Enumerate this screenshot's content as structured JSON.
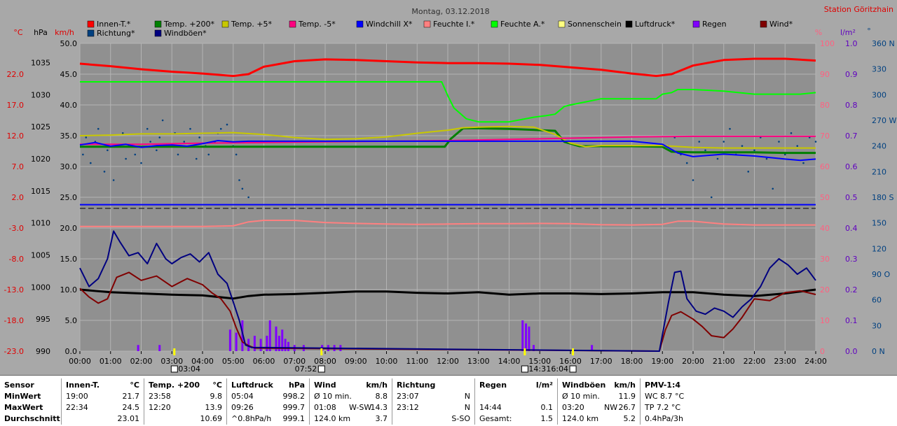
{
  "chart_data": {
    "type": "line",
    "title": "Montag, 03.12.2018",
    "station": "Station Göritzhain",
    "axis_units": {
      "temp": "°C",
      "pressure": "hPa",
      "wind": "km/h",
      "humidity": "%",
      "rain": "l/m²",
      "direction": "°"
    },
    "yaxes": {
      "temp": {
        "range": [
          -23.0,
          27.0
        ],
        "ticks": [
          "22.0",
          "17.0",
          "12.0",
          "7.0",
          "2.0",
          "-3.0",
          "-8.0",
          "-13.0",
          "-18.0",
          "-23.0"
        ]
      },
      "pressure": {
        "range": [
          990,
          1038
        ],
        "ticks": [
          "1035",
          "1030",
          "1025",
          "1020",
          "1015",
          "1010",
          "1005",
          "1000",
          "995",
          "990"
        ]
      },
      "wind": {
        "range": [
          0.0,
          50.0
        ],
        "ticks": [
          "50.0",
          "45.0",
          "40.0",
          "35.0",
          "30.0",
          "25.0",
          "20.0",
          "15.0",
          "10.0",
          "5.0",
          "0.0"
        ]
      },
      "humidity": {
        "range": [
          0,
          100
        ],
        "ticks": [
          "100",
          "90",
          "80",
          "70",
          "60",
          "50",
          "40",
          "30",
          "20",
          "10",
          "0"
        ]
      },
      "rain": {
        "range": [
          0.0,
          1.0
        ],
        "ticks": [
          "1.0",
          "0.9",
          "0.8",
          "0.7",
          "0.6",
          "0.5",
          "0.4",
          "0.3",
          "0.2",
          "0.1",
          "0.0"
        ]
      },
      "direction": {
        "range": [
          0,
          360
        ],
        "ticks": [
          "360 N",
          "330",
          "300",
          "270 W",
          "240",
          "210",
          "180 S",
          "150",
          "120",
          "90 O",
          "60",
          "30",
          "0 N"
        ]
      }
    },
    "x_ticks": [
      "00:00",
      "01:00",
      "02:00",
      "03:00",
      "04:00",
      "05:00",
      "06:00",
      "07:00",
      "08:00",
      "09:00",
      "10:00",
      "11:00",
      "12:00",
      "13:00",
      "14:00",
      "15:00",
      "16:00",
      "17:00",
      "18:00",
      "19:00",
      "20:00",
      "21:00",
      "22:00",
      "23:00",
      "24:00"
    ],
    "x_range": [
      0,
      24
    ],
    "sun_markers": [
      {
        "label": "03:04",
        "x": 3.07
      },
      {
        "label": "07:52",
        "x": 7.87
      },
      {
        "label": "14:3",
        "x": 14.5
      },
      {
        "label": "16:04",
        "x": 16.07
      }
    ],
    "legend": [
      {
        "name": "Innen-T.*",
        "color": "#ff0000"
      },
      {
        "name": "Temp. +200*",
        "color": "#008000"
      },
      {
        "name": "Temp. +5*",
        "color": "#c8c800"
      },
      {
        "name": "Temp. -5*",
        "color": "#ff0080"
      },
      {
        "name": "Windchill X*",
        "color": "#0000ff"
      },
      {
        "name": "Feuchte I.*",
        "color": "#ff8080"
      },
      {
        "name": "Feuchte A.*",
        "color": "#00ff00"
      },
      {
        "name": "Sonnenschein",
        "color": "#ffff80"
      },
      {
        "name": "Luftdruck*",
        "color": "#000000"
      },
      {
        "name": "Regen",
        "color": "#8000ff"
      },
      {
        "name": "Wind*",
        "color": "#800000"
      },
      {
        "name": "Richtung*",
        "color": "#004080"
      },
      {
        "name": "Windböen*",
        "color": "#000080"
      }
    ],
    "series": [
      {
        "name": "Innen-T.*",
        "axis": "temp",
        "color": "#ff0000",
        "width": 3,
        "x": [
          0,
          1,
          2,
          3,
          4,
          5,
          5.5,
          6,
          7,
          8,
          9,
          10,
          11,
          12,
          13,
          14,
          15,
          16,
          17,
          18,
          18.8,
          19.3,
          20,
          21,
          22,
          23,
          24
        ],
        "y": [
          23.7,
          23.3,
          22.8,
          22.4,
          22.1,
          21.7,
          22.0,
          23.2,
          24.1,
          24.4,
          24.3,
          24.1,
          23.9,
          23.8,
          23.8,
          23.7,
          23.5,
          23.1,
          22.7,
          22.1,
          21.7,
          22.0,
          23.4,
          24.3,
          24.5,
          24.5,
          24.2
        ]
      },
      {
        "name": "Temp. +200*",
        "axis": "temp",
        "color": "#008000",
        "width": 3,
        "x": [
          0,
          2,
          4,
          6,
          8,
          10,
          11.9,
          12.1,
          12.5,
          13,
          14,
          15.5,
          15.8,
          16.3,
          17,
          18,
          19,
          19.3,
          20,
          21,
          22,
          23,
          24
        ],
        "y": [
          10.2,
          10.2,
          10.2,
          10.2,
          10.2,
          10.2,
          10.2,
          11.5,
          13.2,
          13.2,
          13.1,
          12.8,
          11.0,
          10.3,
          10.3,
          10.3,
          10.2,
          9.4,
          9.3,
          9.3,
          9.3,
          9.2,
          9.2
        ]
      },
      {
        "name": "Temp. +5*",
        "axis": "temp",
        "color": "#c8c800",
        "width": 2,
        "x": [
          0,
          1,
          2,
          3,
          4,
          5,
          6,
          7,
          8,
          9,
          10,
          11,
          12,
          12.5,
          13,
          14,
          14.8,
          15.5,
          16,
          16.5,
          17,
          18,
          19,
          20,
          21,
          22,
          23,
          24
        ],
        "y": [
          12.0,
          12.1,
          12.3,
          12.3,
          12.4,
          12.5,
          12.2,
          11.7,
          11.4,
          11.5,
          11.8,
          12.4,
          12.9,
          13.3,
          13.4,
          13.5,
          13.4,
          12.2,
          10.8,
          10.2,
          10.4,
          10.4,
          10.4,
          10.1,
          10.0,
          10.0,
          10.0,
          10.0
        ]
      },
      {
        "name": "Temp. -5*",
        "axis": "temp",
        "color": "#ff0080",
        "width": 2,
        "x": [
          0,
          2,
          4,
          6,
          8,
          10,
          12,
          14,
          16,
          18,
          20,
          22,
          24
        ],
        "y": [
          10.6,
          10.6,
          10.8,
          10.9,
          11.0,
          11.1,
          11.2,
          11.4,
          11.6,
          11.8,
          11.9,
          11.9,
          11.9
        ]
      },
      {
        "name": "Windchill X*",
        "axis": "temp",
        "color": "#0000ff",
        "width": 2,
        "x": [
          0,
          0.5,
          1,
          1.5,
          2,
          2.5,
          3,
          3.5,
          4,
          4.5,
          5,
          5.5,
          6,
          7,
          8,
          10,
          12,
          14,
          16,
          18,
          19,
          19.5,
          20,
          21,
          22,
          23,
          23.5,
          24
        ],
        "y": [
          10.5,
          10.9,
          10.3,
          10.6,
          10.1,
          10.4,
          10.5,
          10.3,
          10.7,
          11.2,
          11.0,
          11.1,
          11.1,
          11.1,
          11.1,
          11.1,
          11.1,
          11.1,
          11.1,
          11.1,
          10.6,
          9.2,
          8.6,
          9.0,
          8.7,
          8.2,
          8.0,
          8.2
        ]
      },
      {
        "name": "Windchill X* base",
        "axis": "temp",
        "color": "#0000ff",
        "width": 2,
        "x": [
          0,
          24
        ],
        "y": [
          0.8,
          0.8
        ]
      },
      {
        "name": "Feuchte I.*",
        "axis": "humidity",
        "color": "#ff8080",
        "width": 2,
        "x": [
          0,
          2,
          4,
          5,
          5.5,
          6,
          7,
          8,
          9,
          10,
          11,
          12,
          13,
          14,
          15,
          16,
          17,
          18,
          19,
          19.5,
          20,
          21,
          22,
          23,
          24
        ],
        "y": [
          40.5,
          40.5,
          40.5,
          40.7,
          42.0,
          42.5,
          42.5,
          41.8,
          41.5,
          41.3,
          41.2,
          41.3,
          41.4,
          41.4,
          41.5,
          41.4,
          41.1,
          41.0,
          41.2,
          42.2,
          42.2,
          41.3,
          41.0,
          41.0,
          41.0
        ]
      },
      {
        "name": "Feuchte A.*",
        "axis": "humidity",
        "color": "#00ff00",
        "width": 2,
        "x": [
          0,
          2,
          4,
          6,
          8,
          10,
          11.8,
          12.0,
          12.2,
          12.6,
          13,
          14,
          14.8,
          15.2,
          15.5,
          15.8,
          16,
          16.5,
          17,
          18,
          18.8,
          19.0,
          19.3,
          19.5,
          20,
          21,
          22,
          23,
          23.5,
          24
        ],
        "y": [
          87.5,
          87.5,
          87.5,
          87.5,
          87.5,
          87.5,
          87.5,
          83.0,
          79.0,
          75.5,
          74.5,
          74.5,
          76.0,
          76.5,
          77.0,
          79.5,
          80.0,
          81.0,
          82.0,
          82.0,
          82.0,
          83.5,
          84.0,
          85.0,
          85.0,
          84.5,
          83.5,
          83.5,
          83.5,
          84.0
        ]
      },
      {
        "name": "Luftdruck*",
        "axis": "pressure",
        "color": "#000000",
        "width": 3,
        "x": [
          0,
          1,
          2,
          3,
          4,
          5,
          5.5,
          6,
          7,
          8,
          9,
          10,
          11,
          12,
          13,
          14,
          15,
          16,
          17,
          18,
          19,
          20,
          21,
          22,
          23,
          24
        ],
        "y": [
          999.6,
          999.2,
          999.0,
          998.8,
          998.7,
          998.2,
          998.6,
          998.8,
          998.9,
          999.1,
          999.3,
          999.3,
          999.1,
          999.0,
          999.2,
          998.8,
          999.0,
          999.0,
          998.9,
          999.0,
          999.2,
          999.2,
          998.8,
          998.6,
          999.0,
          999.6
        ]
      },
      {
        "name": "Wind*",
        "axis": "wind",
        "color": "#800000",
        "width": 2,
        "x": [
          0,
          0.3,
          0.6,
          0.9,
          1.2,
          1.6,
          2.0,
          2.5,
          3,
          3.5,
          4,
          4.3,
          4.6,
          4.9,
          5.1,
          5.3,
          5.5,
          5.7,
          18.9,
          19.1,
          19.3,
          19.6,
          20,
          20.3,
          20.6,
          21,
          21.3,
          21.6,
          22,
          22.5,
          23,
          23.5,
          24
        ],
        "y": [
          10.2,
          8.8,
          7.8,
          8.5,
          12.0,
          12.8,
          11.5,
          12.2,
          10.5,
          11.8,
          10.8,
          9.5,
          8.5,
          6.5,
          3.8,
          1.5,
          0.9,
          0.5,
          0,
          3.5,
          5.8,
          6.4,
          5.2,
          4.0,
          2.5,
          2.2,
          3.6,
          5.5,
          8.5,
          8.2,
          9.5,
          9.8,
          9.2
        ]
      },
      {
        "name": "Windböen*",
        "axis": "wind",
        "color": "#000080",
        "width": 2,
        "x": [
          0,
          0.3,
          0.6,
          0.9,
          1.1,
          1.3,
          1.6,
          1.9,
          2.2,
          2.5,
          2.8,
          3.0,
          3.3,
          3.6,
          3.9,
          4.2,
          4.5,
          4.8,
          5.0,
          5.2,
          5.4,
          5.6,
          18.9,
          19.2,
          19.4,
          19.6,
          19.8,
          20.1,
          20.4,
          20.7,
          21,
          21.3,
          21.6,
          21.9,
          22.2,
          22.5,
          22.8,
          23.1,
          23.4,
          23.7,
          24
        ],
        "y": [
          13.5,
          10.5,
          11.8,
          15.0,
          19.5,
          17.8,
          15.5,
          16.0,
          14.2,
          17.5,
          15.0,
          14.2,
          15.2,
          15.8,
          14.5,
          16.0,
          12.5,
          11.0,
          8.0,
          5.0,
          1.0,
          0.6,
          0,
          8.0,
          12.8,
          13.0,
          8.5,
          6.5,
          6.0,
          7.0,
          6.5,
          5.5,
          7.2,
          8.5,
          10.5,
          13.5,
          15.0,
          14.0,
          12.5,
          13.5,
          11.5
        ]
      }
    ],
    "direction_points": {
      "axis": "direction",
      "color": "#004080",
      "x": [
        0.1,
        0.2,
        0.35,
        0.5,
        0.6,
        0.8,
        0.9,
        1.1,
        1.2,
        1.4,
        1.5,
        1.6,
        1.8,
        2.0,
        2.2,
        2.3,
        2.5,
        2.6,
        2.7,
        2.9,
        3.1,
        3.2,
        3.4,
        3.6,
        3.8,
        3.9,
        4.1,
        4.2,
        4.4,
        4.5,
        4.6,
        4.8,
        5.0,
        5.1,
        5.2,
        5.3,
        5.5,
        19.2,
        19.4,
        19.6,
        19.8,
        20.0,
        20.2,
        20.4,
        20.6,
        20.8,
        21.0,
        21.2,
        21.4,
        21.6,
        21.8,
        22.0,
        22.2,
        22.4,
        22.6,
        22.8,
        23.0,
        23.2,
        23.4,
        23.6,
        23.8,
        24.0
      ],
      "y": [
        230,
        250,
        220,
        245,
        260,
        210,
        235,
        200,
        240,
        255,
        225,
        240,
        230,
        220,
        260,
        245,
        235,
        250,
        270,
        240,
        255,
        230,
        245,
        260,
        225,
        250,
        240,
        230,
        245,
        255,
        260,
        265,
        240,
        230,
        200,
        190,
        180,
        240,
        250,
        230,
        220,
        200,
        245,
        235,
        180,
        225,
        245,
        260,
        230,
        240,
        210,
        235,
        250,
        225,
        190,
        245,
        230,
        255,
        240,
        220,
        250,
        245
      ]
    },
    "rain_bars": {
      "axis": "rain",
      "color": "#8000ff",
      "x": [
        1.9,
        2.6,
        4.9,
        5.1,
        5.3,
        5.5,
        5.7,
        5.9,
        6.1,
        6.2,
        6.4,
        6.5,
        6.6,
        6.7,
        6.8,
        7.0,
        7.3,
        7.9,
        8.1,
        8.3,
        8.5,
        14.44,
        14.55,
        14.65,
        14.8,
        16.7
      ],
      "y": [
        0.02,
        0.02,
        0.07,
        0.06,
        0.1,
        0.04,
        0.05,
        0.04,
        0.05,
        0.1,
        0.08,
        0.05,
        0.07,
        0.04,
        0.03,
        0.02,
        0.02,
        0.02,
        0.02,
        0.02,
        0.02,
        0.1,
        0.09,
        0.08,
        0.02,
        0.02
      ]
    },
    "reference_lines": [
      {
        "axis": "temp",
        "y": 0.2,
        "color": "#000000",
        "style": "dashed"
      }
    ]
  },
  "stats": {
    "labels": {
      "sensor": "Sensor",
      "min": "MinWert",
      "max": "MaxWert",
      "avg": "Durchschnitt"
    },
    "innen": {
      "title": "Innen-T.",
      "unit": "°C",
      "min_time": "19:00",
      "min_val": "21.7",
      "max_time": "22:34",
      "max_val": "24.5",
      "avg_val": "23.01"
    },
    "temp200": {
      "title": "Temp. +200",
      "unit": "°C",
      "min_time": "23:58",
      "min_val": "9.8",
      "max_time": "12:20",
      "max_val": "13.9",
      "avg_val": "10.69"
    },
    "druck": {
      "title": "Luftdruck",
      "unit": "hPa",
      "min_time": "05:04",
      "min_val": "998.2",
      "max_time": "09:26",
      "max_val": "999.7",
      "avg_time": "^0.8hPa/h",
      "avg_val": "999.1"
    },
    "wind": {
      "title": "Wind",
      "unit": "km/h",
      "min_time": "Ø 10 min.",
      "min_val": "8.8",
      "max_time": "01:08",
      "max_dir": "W-SW",
      "max_val": "14.3",
      "avg_time": "124.0 km",
      "avg_val": "3.7"
    },
    "richtung": {
      "title": "Richtung",
      "min_time": "23:07",
      "min_val": "N",
      "max_time": "23:12",
      "max_val": "N",
      "avg_val": "S-SO"
    },
    "regen": {
      "title": "Regen",
      "unit": "l/m²",
      "max_time": "14:44",
      "max_val": "0.1",
      "avg_time": "Gesamt:",
      "avg_val": "1.5"
    },
    "boeen": {
      "title": "Windböen",
      "unit": "km/h",
      "min_time": "Ø 10 min.",
      "min_val": "11.9",
      "max_time": "03:20",
      "max_dir": "NW",
      "max_val": "26.7",
      "avg_time": "124.0 km",
      "avg_val": "5.2"
    },
    "pmv": {
      "title": "PMV-1:4",
      "line1": "WC 8.7 °C",
      "line2": "TP 7.2 °C",
      "line3": "0.4hPa/3h"
    }
  }
}
